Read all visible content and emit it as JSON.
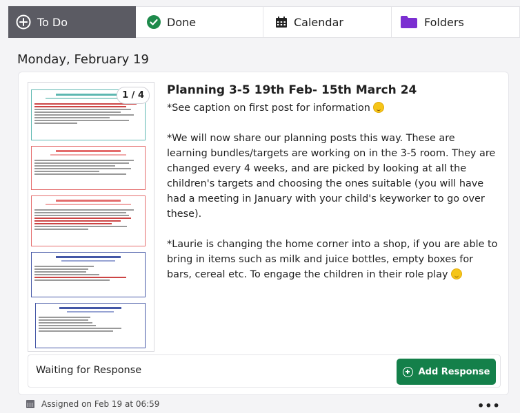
{
  "tabs": [
    {
      "label": "To Do",
      "icon": "plus-circle-icon",
      "active": true
    },
    {
      "label": "Done",
      "icon": "check-circle-icon"
    },
    {
      "label": "Calendar",
      "icon": "calendar-icon"
    },
    {
      "label": "Folders",
      "icon": "folder-icon"
    }
  ],
  "date_heading": "Monday, February 19",
  "post": {
    "image_counter": "1 / 4",
    "title": "Planning 3-5 19th Feb- 15th March 24",
    "caption_line": "*See caption on first post for information",
    "paragraph_1": "*We will now share our planning posts this way. These are learning bundles/targets are working on in the 3-5 room. They are changed every 4 weeks, and are picked by looking at all the children's targets and choosing the ones suitable (you will have had a meeting in January with your child's keyworker to go over these).",
    "paragraph_2": "*Laurie is changing the home corner into a shop, if you are able to bring in items such as milk and juice bottles, empty boxes for bars, cereal etc. To engage the children in their role play"
  },
  "response": {
    "status": "Waiting for Response",
    "button_label": "Add Response"
  },
  "footer": {
    "assigned": "Assigned on Feb 19 at 06:59"
  },
  "colors": {
    "active_tab": "#5b5b63",
    "accent_green": "#14804a",
    "done_green": "#1e8a4b",
    "folder_purple": "#7b2fd1"
  }
}
